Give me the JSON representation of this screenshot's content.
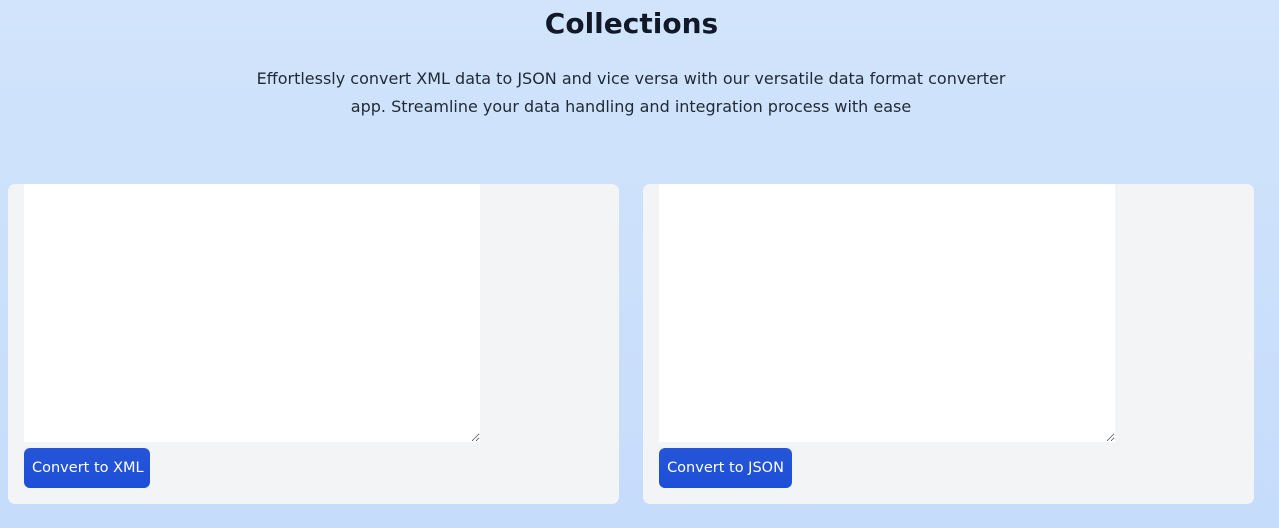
{
  "header": {
    "title": "Collections",
    "subtitle": "Effortlessly convert XML data to JSON and vice versa with our versatile data format converter app. Streamline your data handling and integration process with ease"
  },
  "panels": [
    {
      "input_value": "",
      "button_label": "Convert to XML"
    },
    {
      "input_value": "",
      "button_label": "Convert to JSON"
    }
  ],
  "colors": {
    "background": "#cfe3fb",
    "panel": "#f3f4f6",
    "button": "#1d4ed8",
    "title": "#111827"
  }
}
